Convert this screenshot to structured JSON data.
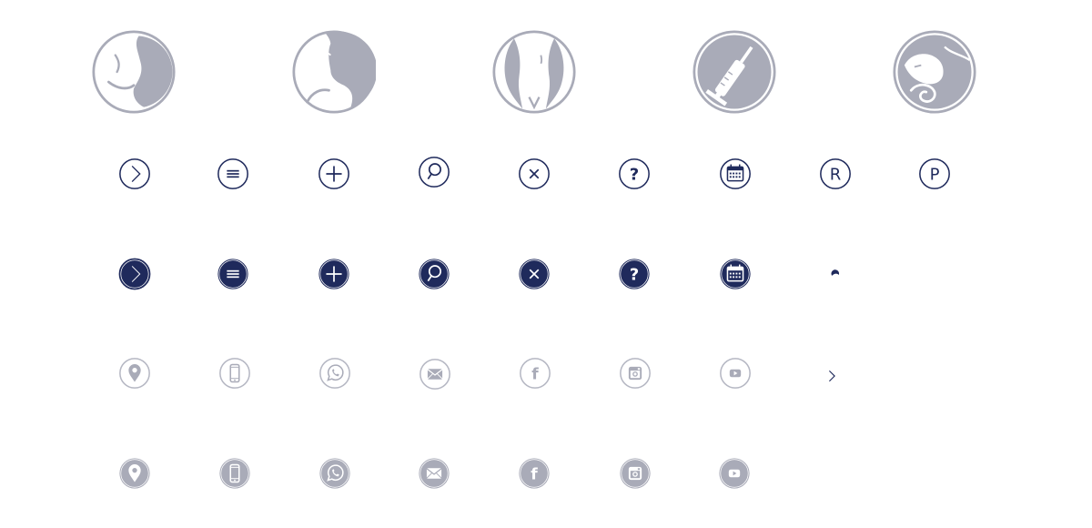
{
  "colors": {
    "navy": "#1f2a5c",
    "gray": "#a9abb8",
    "gray_light": "#b5b7c3",
    "white": "#ffffff"
  },
  "treatment_icons": [
    {
      "icon": "breast-treatment-icon"
    },
    {
      "icon": "face-treatment-icon"
    },
    {
      "icon": "body-contour-icon"
    },
    {
      "icon": "injection-syringe-icon"
    },
    {
      "icon": "face-massage-icon"
    }
  ],
  "outline_icons": [
    {
      "icon": "chevron-right-icon"
    },
    {
      "icon": "menu-icon"
    },
    {
      "icon": "plus-icon"
    },
    {
      "icon": "search-icon"
    },
    {
      "icon": "close-icon"
    },
    {
      "icon": "help-icon",
      "glyph": "?"
    },
    {
      "icon": "calendar-icon"
    },
    {
      "icon": "registered-icon",
      "glyph": "R"
    },
    {
      "icon": "parking-icon",
      "glyph": "P"
    }
  ],
  "filled_icons": [
    {
      "icon": "chevron-right-icon"
    },
    {
      "icon": "menu-icon"
    },
    {
      "icon": "plus-icon"
    },
    {
      "icon": "search-icon"
    },
    {
      "icon": "close-icon"
    },
    {
      "icon": "help-icon",
      "glyph": "?"
    },
    {
      "icon": "calendar-icon"
    },
    {
      "icon": "dot-icon"
    }
  ],
  "contact_outline_icons": [
    {
      "icon": "location-pin-icon"
    },
    {
      "icon": "mobile-phone-icon"
    },
    {
      "icon": "whatsapp-icon"
    },
    {
      "icon": "email-icon"
    },
    {
      "icon": "facebook-icon",
      "glyph": "f"
    },
    {
      "icon": "instagram-icon"
    },
    {
      "icon": "youtube-icon"
    },
    {
      "icon": "small-chevron-right-icon"
    }
  ],
  "contact_filled_icons": [
    {
      "icon": "location-pin-icon"
    },
    {
      "icon": "mobile-phone-icon"
    },
    {
      "icon": "whatsapp-icon"
    },
    {
      "icon": "email-icon"
    },
    {
      "icon": "facebook-icon",
      "glyph": "f"
    },
    {
      "icon": "instagram-icon"
    },
    {
      "icon": "youtube-icon"
    }
  ]
}
